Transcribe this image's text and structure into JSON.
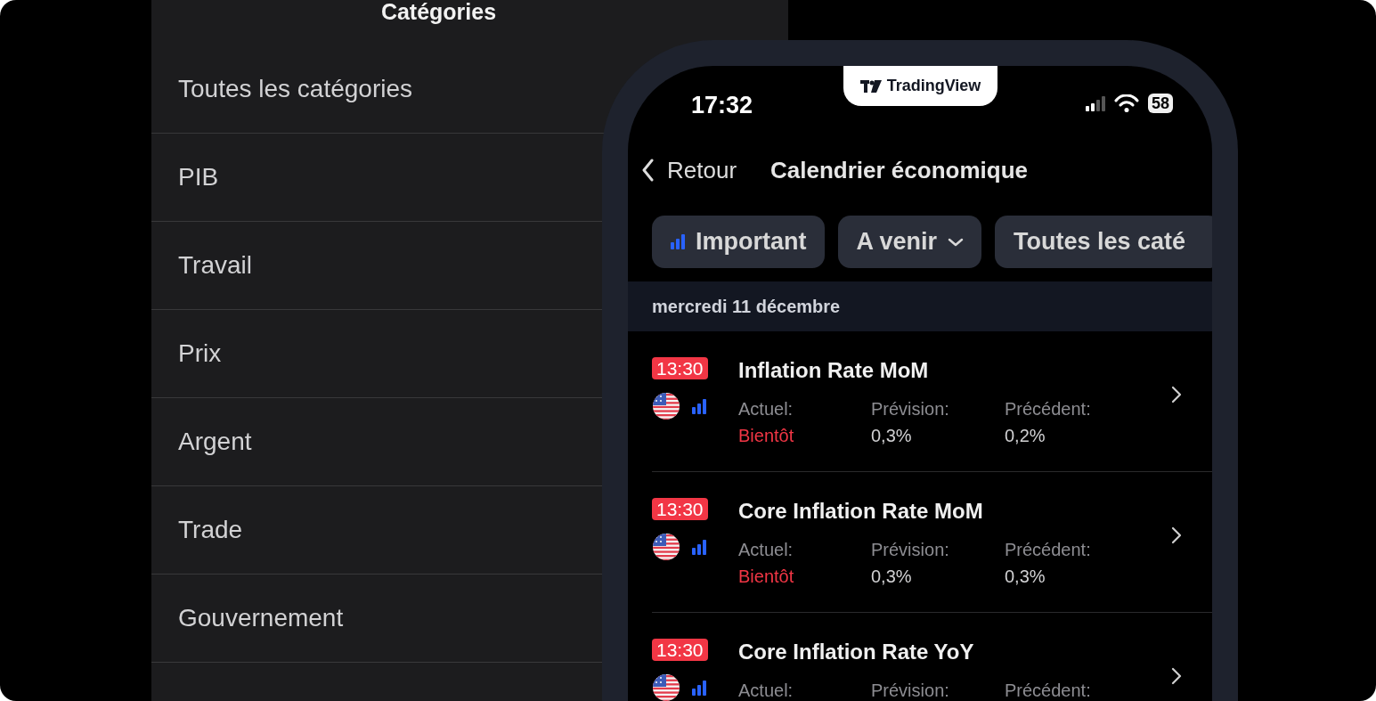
{
  "categories_panel": {
    "title": "Catégories",
    "items": [
      {
        "label": "Toutes les catégories"
      },
      {
        "label": "PIB"
      },
      {
        "label": "Travail"
      },
      {
        "label": "Prix"
      },
      {
        "label": "Argent"
      },
      {
        "label": "Trade"
      },
      {
        "label": "Gouvernement"
      }
    ]
  },
  "phone": {
    "status_bar": {
      "time": "17:32",
      "brand": "TradingView",
      "battery": "58"
    },
    "nav": {
      "back": "Retour",
      "title": "Calendrier économique"
    },
    "filters": [
      {
        "kind": "importance",
        "label": "Important"
      },
      {
        "kind": "dropdown",
        "label": "A venir"
      },
      {
        "kind": "plain",
        "label": "Toutes les caté"
      }
    ],
    "date_header": "mercredi 11 décembre",
    "events": [
      {
        "time": "13:30",
        "title": "Inflation Rate MoM",
        "actual_label": "Actuel:",
        "actual": "Bientôt",
        "forecast_label": "Prévision:",
        "forecast": "0,3%",
        "previous_label": "Précédent:",
        "previous": "0,2%"
      },
      {
        "time": "13:30",
        "title": "Core Inflation Rate MoM",
        "actual_label": "Actuel:",
        "actual": "Bientôt",
        "forecast_label": "Prévision:",
        "forecast": "0,3%",
        "previous_label": "Précédent:",
        "previous": "0,3%"
      },
      {
        "time": "13:30",
        "title": "Core Inflation Rate YoY",
        "actual_label": "Actuel:",
        "forecast_label": "Prévision:",
        "previous_label": "Précédent:"
      }
    ]
  }
}
